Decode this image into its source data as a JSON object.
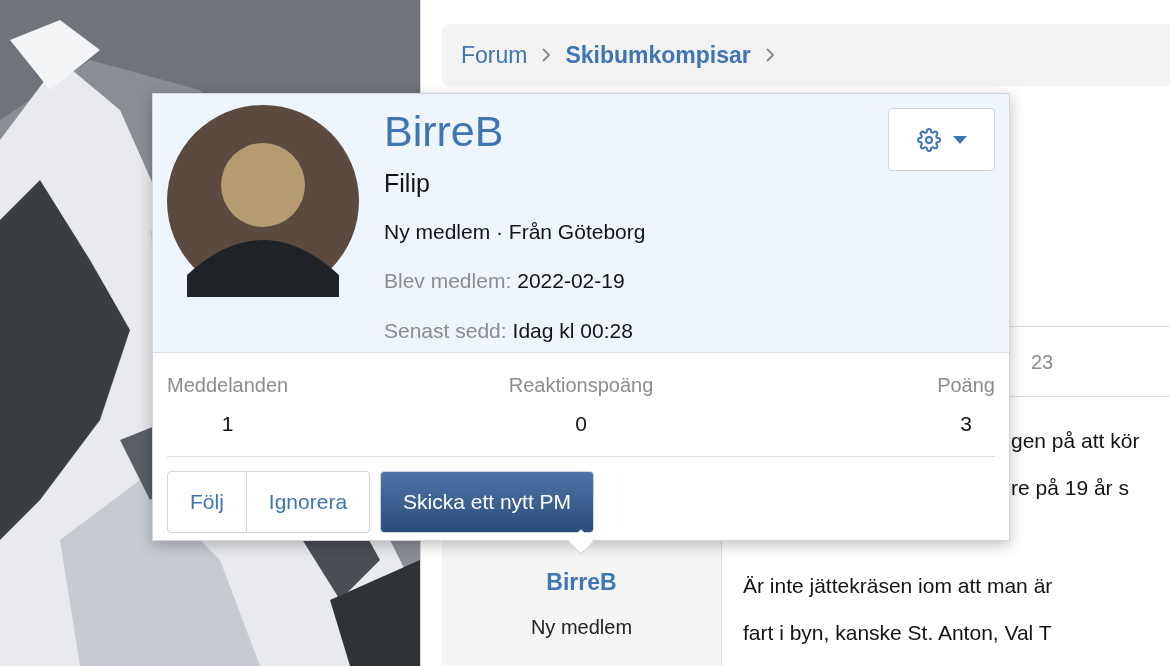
{
  "breadcrumb": [
    {
      "label": "Forum",
      "current": false
    },
    {
      "label": "Skibumkompisar",
      "current": true
    }
  ],
  "post": {
    "date": "23",
    "body_lines": [
      {
        "text": "gen på att kör",
        "kind": "covered"
      },
      {
        "text": "re på 19 år s",
        "kind": "covered"
      },
      {
        "text": "Är inte jättekräsen iom att man är",
        "kind": "full"
      },
      {
        "text": "fart i byn, kanske St. Anton, Val T",
        "kind": "full"
      }
    ],
    "author": {
      "name": "BirreB",
      "title": "Ny medlem"
    }
  },
  "member_card": {
    "username": "BirreB",
    "real_name": "Filip",
    "summary": "Ny medlem · Från Göteborg",
    "facts": [
      {
        "label": "Blev medlem:",
        "value": "2022-02-19"
      },
      {
        "label": "Senast sedd:",
        "value": "Idag kl 00:28"
      }
    ],
    "stats": [
      {
        "label": "Meddelanden",
        "value": "1"
      },
      {
        "label": "Reaktionspoäng",
        "value": "0"
      },
      {
        "label": "Poäng",
        "value": "3"
      }
    ],
    "buttons": [
      {
        "label": "Följ",
        "kind": "secondary"
      },
      {
        "label": "Ignorera",
        "kind": "secondary"
      },
      {
        "label": "Skicka ett nytt PM",
        "kind": "primary"
      }
    ]
  }
}
